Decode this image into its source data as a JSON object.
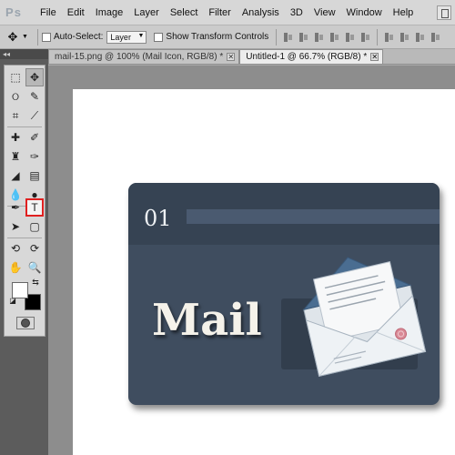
{
  "app": {
    "logo": "Ps"
  },
  "menu": [
    "File",
    "Edit",
    "Image",
    "Layer",
    "Select",
    "Filter",
    "Analysis",
    "3D",
    "View",
    "Window",
    "Help"
  ],
  "options": {
    "auto_select_label": "Auto-Select:",
    "auto_select_value": "Layer",
    "show_transform_label": "Show Transform Controls"
  },
  "tabs": [
    {
      "label": "mail-15.png @ 100% (Mail Icon, RGB/8) *",
      "active": false
    },
    {
      "label": "Untitled-1 @ 66.7% (RGB/8) *",
      "active": true
    }
  ],
  "panel": {
    "collapse_glyph": "◂◂"
  },
  "toolbox": {
    "selected_tool": "type-tool",
    "type_tool_glyph": "T"
  },
  "colors": {
    "foreground": "#ffffff",
    "background": "#000000",
    "highlight": "#e02020",
    "card": "#3f4d5f"
  },
  "card": {
    "number": "01",
    "title": "Mail"
  }
}
